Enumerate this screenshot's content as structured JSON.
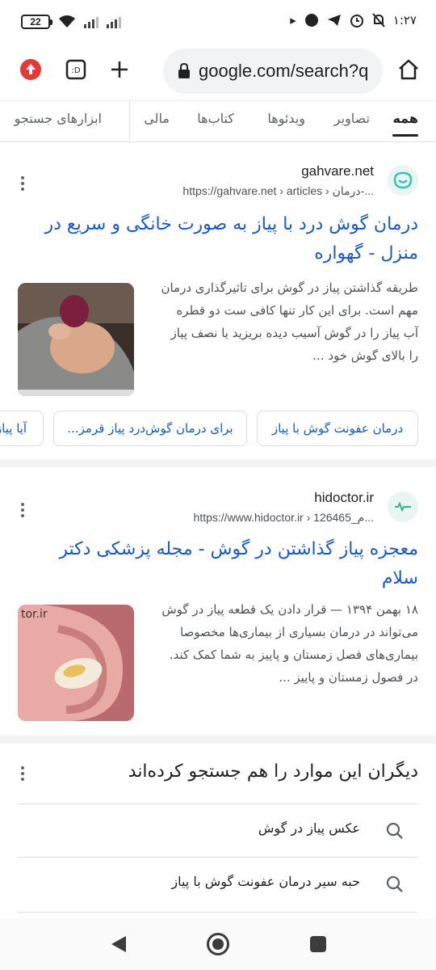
{
  "status_bar": {
    "battery": "22",
    "time": "۱:۲۷"
  },
  "browser": {
    "url": "google.com/search?q"
  },
  "tabs": [
    {
      "label": "همه",
      "active": true
    },
    {
      "label": "تصاویر"
    },
    {
      "label": "ویدئوها"
    },
    {
      "label": "کتاب‌ها"
    },
    {
      "label": "مالی"
    },
    {
      "label": "ابزارهای جستجو"
    }
  ],
  "results": [
    {
      "site": "gahvare.net",
      "url": "https://gahvare.net › articles › درمان-...",
      "title": "درمان گوش درد با پیاز به صورت خانگی و سریع در منزل - گهواره",
      "snippet": "طریقه گذاشتن پیاز در گوش برای تاثیرگذاری درمان مهم است. برای این کار تنها کافی ست دو قطره آب پیاز را در گوش آسیب دیده بریزید یا نصف پیاز را بالای گوش خود ...",
      "chips": [
        "درمان عفونت گوش با پیاز",
        "برای درمان گوش‌درد پیاز قرمز...",
        "آیا پیاز"
      ]
    },
    {
      "site": "hidoctor.ir",
      "url": "https://www.hidoctor.ir › 126465_م...",
      "title": "معجزه پیاز گذاشتن در گوش - مجله پزشکی دکتر سلام",
      "snippet": "۱۸ بهمن ۱۳۹۴ — قرار دادن یک قطعه پیاز در گوش می‌تواند در درمان بسیاری از بیماری‌ها مخصوصا بیماری‌های فصل زمستان و پاییز به شما کمک کند. در فصول زمستان و پاییز ...",
      "thumb_watermark": "tor.ir"
    }
  ],
  "related": {
    "title": "دیگران این موارد را هم جستجو کرده‌اند",
    "items": [
      "عکس پیاز در گوش",
      "حبه سیر درمان عفونت گوش با پیاز"
    ]
  },
  "colors": {
    "link": "#1558d6",
    "accent_red": "#e53935"
  }
}
